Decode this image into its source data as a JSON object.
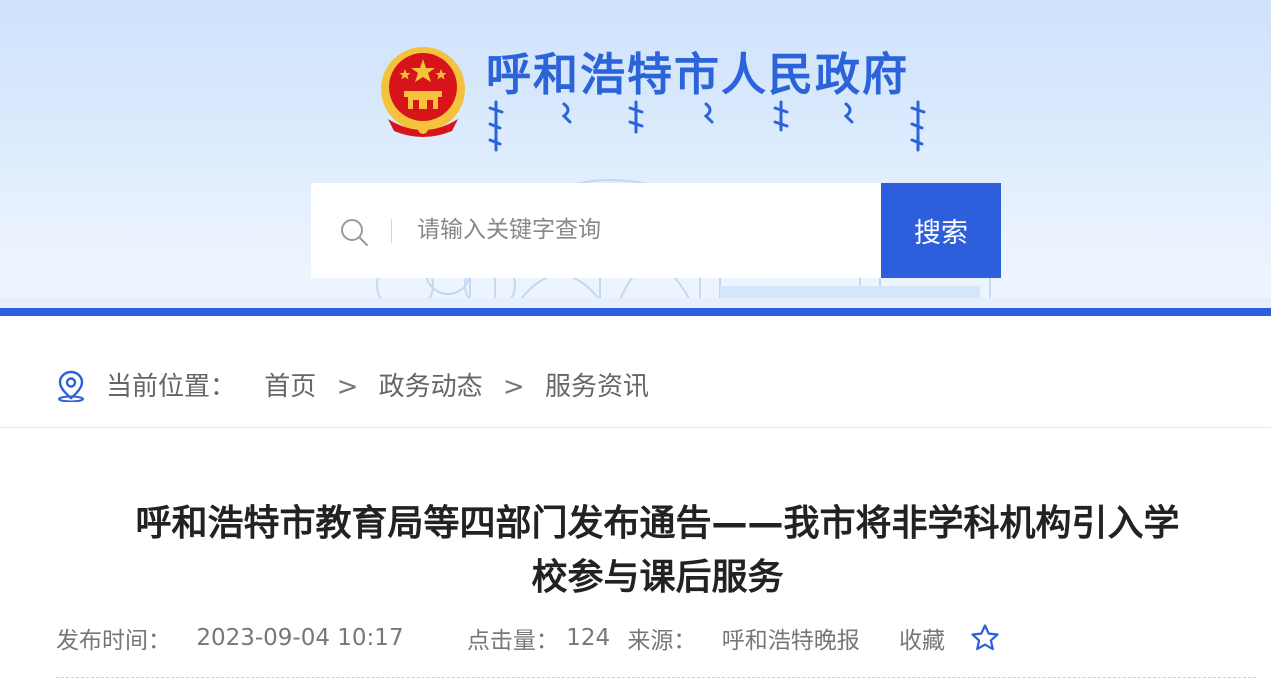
{
  "header": {
    "site_title": "呼和浩特市人民政府",
    "emblem": "national-emblem",
    "mongolian_title": "mongolian-script-title"
  },
  "search": {
    "placeholder": "请输入关键字查询",
    "value": "",
    "button_label": "搜索",
    "icon": "search-icon"
  },
  "colors": {
    "primary": "#2d5fdc",
    "title": "#2b63d9",
    "emblem_red": "#d7141a",
    "emblem_gold": "#f4c23d"
  },
  "breadcrumb": {
    "icon": "location-pin-icon",
    "prefix": "当前位置：",
    "items": [
      "首页",
      "政务动态",
      "服务资讯"
    ],
    "separator": ">"
  },
  "article": {
    "title_line1": "呼和浩特市教育局等四部门发布通告——我市将非学科机构引入学",
    "title_line2": "校参与课后服务",
    "publish_label": "发布时间：",
    "publish_time": "2023-09-04 10:17",
    "clicks_label": "点击量：",
    "clicks_value": "124",
    "source_label": "来源：",
    "source_value": "呼和浩特晚报",
    "favorite_label": "收藏",
    "favorite_icon": "star-icon"
  }
}
